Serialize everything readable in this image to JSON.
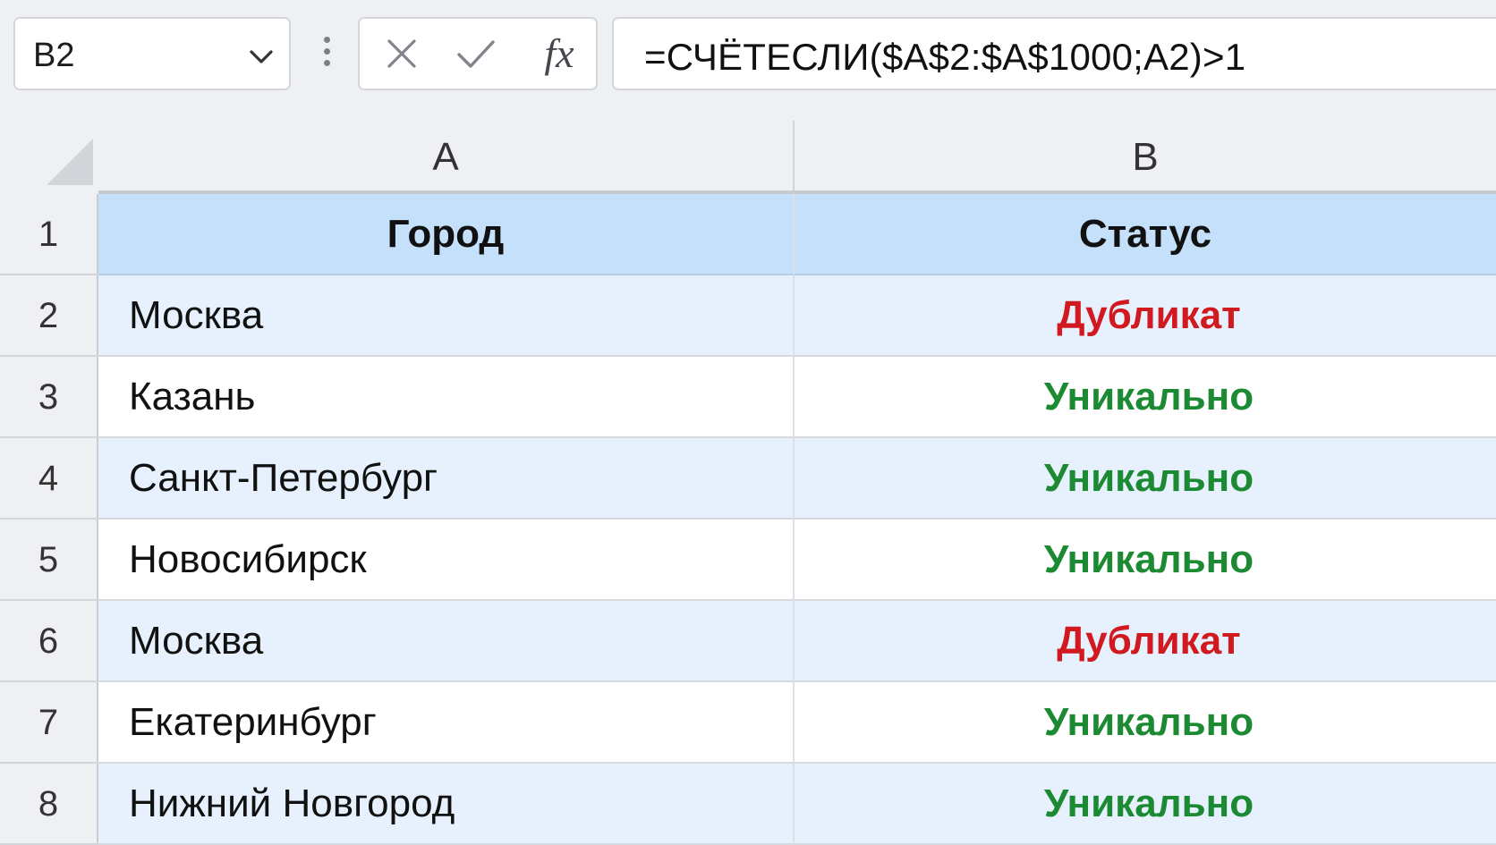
{
  "name_box": {
    "value": "B2"
  },
  "formula_bar": {
    "cancel_icon": "close-icon",
    "enter_icon": "check-icon",
    "function_label": "fx",
    "formula": "=СЧЁТЕСЛИ($A$2:$A$1000;A2)>1"
  },
  "columns": [
    {
      "label": "A"
    },
    {
      "label": "B"
    }
  ],
  "colors": {
    "header_fill": "#c5e0fa",
    "band_fill": "#e6f1fd",
    "duplicate_text": "#d11a1f",
    "unique_text": "#1c8a33"
  },
  "rows": [
    {
      "num": "1",
      "a": "Город",
      "b": "Статус"
    },
    {
      "num": "2",
      "a": "Москва",
      "b": "Дубликат"
    },
    {
      "num": "3",
      "a": "Казань",
      "b": "Уникально"
    },
    {
      "num": "4",
      "a": "Санкт-Петербург",
      "b": "Уникально"
    },
    {
      "num": "5",
      "a": "Новосибирск",
      "b": "Уникально"
    },
    {
      "num": "6",
      "a": "Москва",
      "b": "Дубликат"
    },
    {
      "num": "7",
      "a": "Екатеринбург",
      "b": "Уникально"
    },
    {
      "num": "8",
      "a": "Нижний Новгород",
      "b": "Уникально"
    }
  ]
}
